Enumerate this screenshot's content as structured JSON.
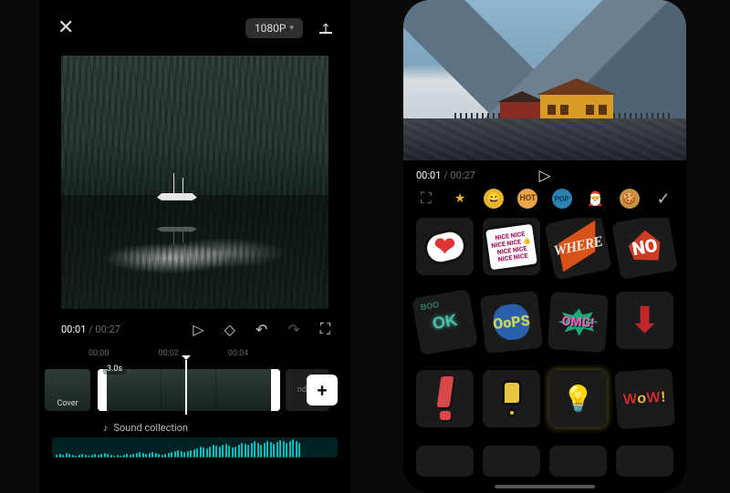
{
  "left": {
    "resolution_label": "1080P",
    "time_current": "00:01",
    "time_total": "00:27",
    "ruler": [
      "00:00",
      "00:02",
      "00:04"
    ],
    "cover_label": "Cover",
    "clip_duration_label": "3.0s",
    "ending_label": "nding",
    "sound_label": "Sound collection",
    "add_label": "+"
  },
  "right": {
    "time_current": "00:01",
    "time_total": "00:27",
    "categories": {
      "image": "⛶",
      "star": "★",
      "smile": "😀",
      "hot": "HOT",
      "pop": "POP",
      "santa": "🎅",
      "cookie": "🍪",
      "check": "✓"
    },
    "stickers": {
      "heart": "❤",
      "nice": "NICE NICE NICE\nNICE 👍 NICE\nNICE NICE NICE",
      "where": "WHERE",
      "no": "NO",
      "ok": "OK",
      "oops": "OoPS",
      "omg": "OMG!",
      "arrow": "⬇",
      "bulb": "💡",
      "wow_1": "W",
      "wow_2": "o",
      "wow_3": "W",
      "wow_4": "!"
    }
  }
}
